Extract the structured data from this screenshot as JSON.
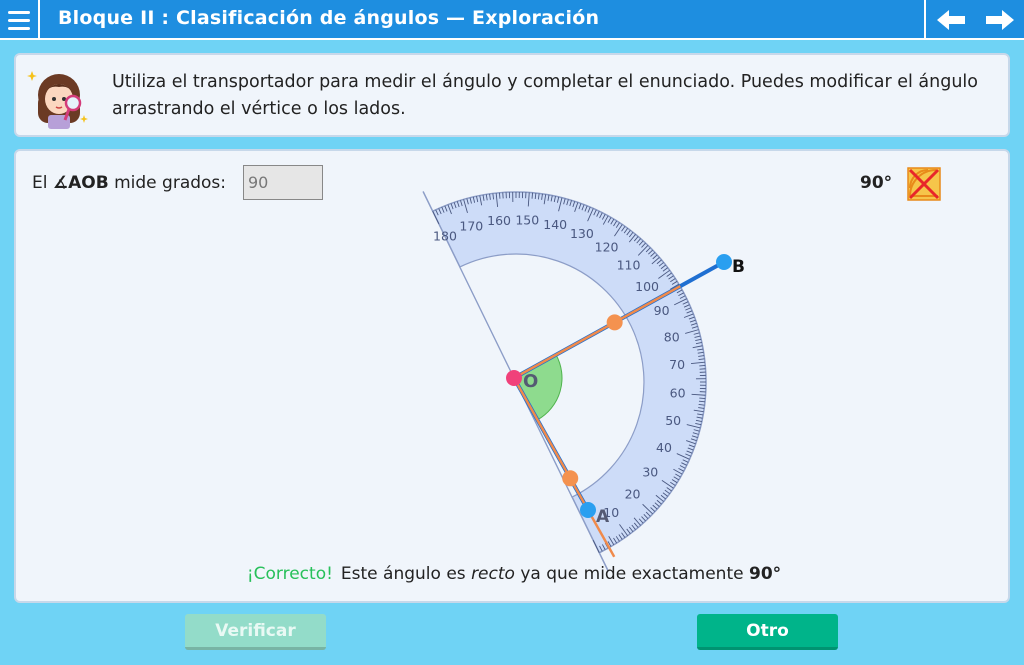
{
  "header": {
    "title": "Bloque II : Clasificación de ángulos  —  Exploración"
  },
  "instructions": {
    "text": "Utiliza el transportador para medir el ángulo y completar el enunciado. Puedes modificar el ángulo arrastrando el vértice o los lados."
  },
  "statement": {
    "prefix": "El ",
    "angle_symbol": "∡",
    "angle_name": "AOB",
    "suffix": " mide grados:",
    "answer_value": "90"
  },
  "angle_reading": "90°",
  "protractor": {
    "labels": [
      "180",
      "170",
      "160",
      "150",
      "140",
      "130",
      "120",
      "110",
      "100",
      "90",
      "80",
      "70",
      "60",
      "50",
      "40",
      "30",
      "20",
      "10"
    ]
  },
  "points": {
    "vertex_label": "O",
    "point_a_label": "A",
    "point_b_label": "B"
  },
  "feedback": {
    "correct": "¡Correcto!",
    "text_before": "Este ángulo es ",
    "emphasis": "recto",
    "text_middle": " ya que mide exactamente ",
    "value": "90°"
  },
  "buttons": {
    "verify": "Verificar",
    "other": "Otro"
  },
  "colors": {
    "topbar": "#1e8ee0",
    "background": "#6fd3f5",
    "correct": "#27c05a",
    "button_other": "#00b48a",
    "button_verify_disabled": "#93dcc9"
  }
}
